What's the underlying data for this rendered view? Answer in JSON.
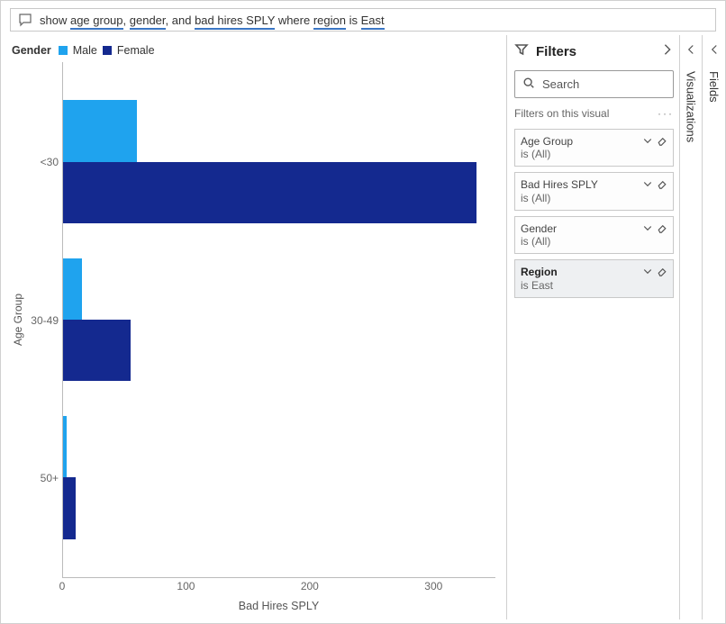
{
  "qa": {
    "prefix": "show ",
    "t1": "age group",
    "sep1": ", ",
    "t2": "gender",
    "sep2": ", and ",
    "t3": "bad hires SPLY",
    "sep3": " where ",
    "t4": "region",
    "sep4": " is ",
    "t5": "East"
  },
  "legend": {
    "title": "Gender",
    "male": "Male",
    "female": "Female"
  },
  "axes": {
    "y_label": "Age Group",
    "x_label": "Bad Hires SPLY"
  },
  "chart_data": {
    "type": "bar",
    "orientation": "horizontal",
    "categories": [
      "<30",
      "30-49",
      "50+"
    ],
    "series": [
      {
        "name": "Male",
        "color": "#1fa3ee",
        "values": [
          60,
          15,
          3
        ]
      },
      {
        "name": "Female",
        "color": "#14298f",
        "values": [
          335,
          55,
          10
        ]
      }
    ],
    "xlabel": "Bad Hires SPLY",
    "ylabel": "Age Group",
    "xlim": [
      0,
      350
    ],
    "xticks": [
      0,
      100,
      200,
      300
    ]
  },
  "filters": {
    "title": "Filters",
    "search_placeholder": "Search",
    "section": "Filters on this visual",
    "cards": [
      {
        "name": "Age Group",
        "cond": "is (All)",
        "active": false
      },
      {
        "name": "Bad Hires SPLY",
        "cond": "is (All)",
        "active": false
      },
      {
        "name": "Gender",
        "cond": "is (All)",
        "active": false
      },
      {
        "name": "Region",
        "cond": "is East",
        "active": true
      }
    ]
  },
  "side": {
    "viz": "Visualizations",
    "fields": "Fields"
  }
}
